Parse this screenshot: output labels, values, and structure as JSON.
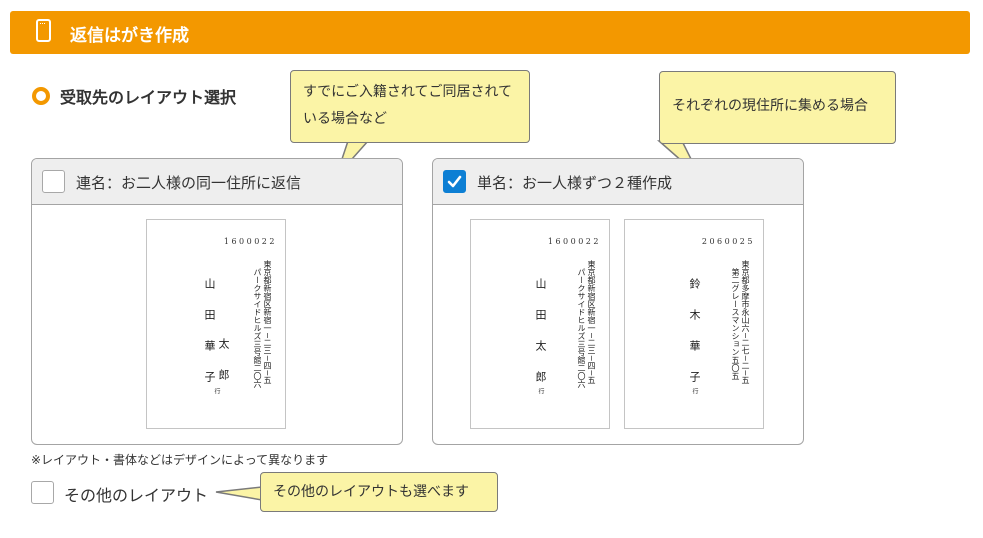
{
  "header": {
    "title": "返信はがき作成",
    "icon": "postcard-icon"
  },
  "section": {
    "title": "受取先のレイアウト選択"
  },
  "tooltips": {
    "joint": "すでにご入籍されてご同居されている場合など",
    "single": "それぞれの現住所に集める場合",
    "other": "その他のレイアウトも選べます"
  },
  "cards": {
    "joint": {
      "label": "連名：お二人様の同一住所に返信",
      "checked": false,
      "postcard": {
        "zip": "1600022",
        "address_line1": "東京都新宿区新宿一−二三−四−五",
        "address_line2": "パークサイドヒルズ三号館二〇六",
        "name_col1": "山田華子",
        "name_col2": "太郎",
        "suffix": "行"
      }
    },
    "single": {
      "label": "単名：お一人様ずつ２種作成",
      "checked": true,
      "postcards": [
        {
          "zip": "1600022",
          "address_line1": "東京都新宿区新宿一−二三−四−五",
          "address_line2": "パークサイドヒルズ三号館二〇六",
          "name": "山田太郎",
          "suffix": "行"
        },
        {
          "zip": "2060025",
          "address_line1": "東京都多摩市永山六−二七−二−五",
          "address_line2": "第二グレースマンション五〇五",
          "name": "鈴木華子",
          "suffix": "行"
        }
      ]
    }
  },
  "note": "※レイアウト・書体などはデザインによって異なります",
  "other_layout": {
    "label": "その他のレイアウト",
    "checked": false
  },
  "colors": {
    "accent": "#f39800",
    "check": "#0d7fd4",
    "tooltip_bg": "#fbf4a6"
  }
}
